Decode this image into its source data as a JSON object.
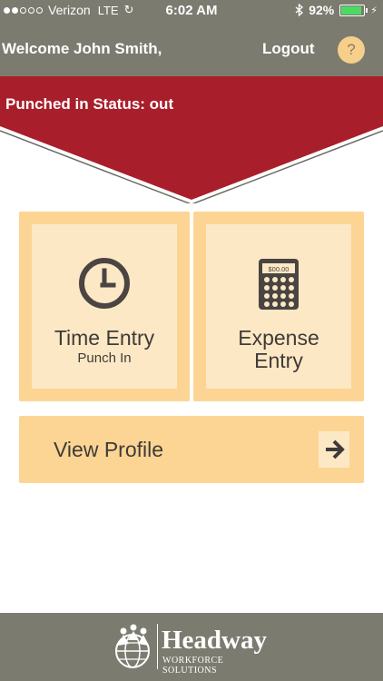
{
  "status_bar": {
    "carrier": "Verizon",
    "network": "LTE",
    "time": "6:02 AM",
    "battery_percent": "92%",
    "battery_level": 0.92,
    "signal_bars_filled": 2,
    "signal_bars_total": 5
  },
  "header": {
    "welcome_text": "Welcome John Smith,",
    "logout_label": "Logout",
    "help_label": "?"
  },
  "banner": {
    "status_text": "Punched in Status: out"
  },
  "tiles": {
    "time_entry": {
      "title": "Time Entry",
      "subtitle": "Punch In"
    },
    "expense_entry": {
      "title_line1": "Expense",
      "title_line2": "Entry",
      "display_text": "$00.00"
    }
  },
  "profile": {
    "label": "View Profile"
  },
  "footer": {
    "brand_name": "Headway",
    "brand_tagline": "WORKFORCE SOLUTIONS"
  },
  "colors": {
    "header_gray": "#7b7b70",
    "banner_red": "#a91e2b",
    "tile_orange": "#fcd594",
    "tile_inner": "#fde8c6",
    "text_dark": "#3f3b38",
    "help_button": "#f6cf8a"
  },
  "icons": {
    "clock": "clock-icon",
    "calculator": "calculator-icon",
    "arrow": "arrow-right-icon",
    "bluetooth": "bluetooth-icon",
    "sync": "sync-icon",
    "battery": "battery-icon",
    "logo": "headway-globe-logo"
  }
}
